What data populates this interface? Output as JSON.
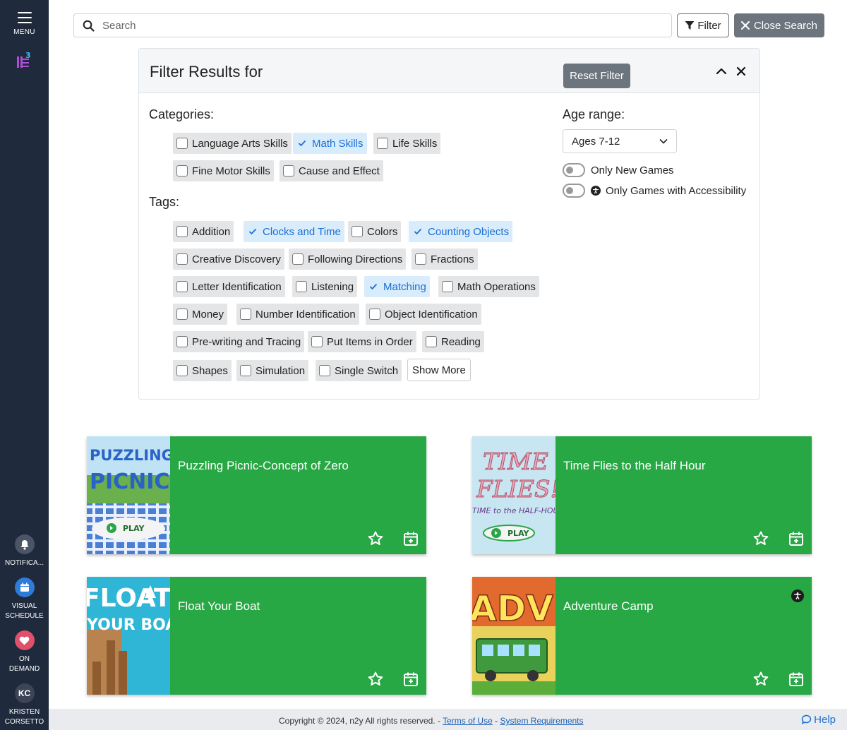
{
  "sidebar": {
    "menu_label": "MENU",
    "items": [
      {
        "label1": "NOTIFICA...",
        "label2": ""
      },
      {
        "label1": "VISUAL",
        "label2": "SCHEDULE"
      },
      {
        "label1": "ON",
        "label2": "DEMAND"
      },
      {
        "initials": "KC",
        "label1": "KRISTEN",
        "label2": "CORSETTO"
      }
    ]
  },
  "search": {
    "placeholder": "Search",
    "value": ""
  },
  "toolbar": {
    "filter_label": "Filter",
    "close_search_label": "Close Search"
  },
  "filter_panel": {
    "title": "Filter Results for",
    "reset_label": "Reset Filter",
    "categories_label": "Categories:",
    "categories": [
      {
        "label": "Language Arts Skills",
        "checked": false
      },
      {
        "label": "Math Skills",
        "checked": true
      },
      {
        "label": "Life Skills",
        "checked": false
      },
      {
        "label": "Fine Motor Skills",
        "checked": false
      },
      {
        "label": "Cause and Effect",
        "checked": false
      }
    ],
    "tags_label": "Tags:",
    "tags": [
      {
        "label": "Addition",
        "checked": false
      },
      {
        "label": "Clocks and Time",
        "checked": true
      },
      {
        "label": "Colors",
        "checked": false
      },
      {
        "label": "Counting Objects",
        "checked": true
      },
      {
        "label": "Creative Discovery",
        "checked": false
      },
      {
        "label": "Following Directions",
        "checked": false
      },
      {
        "label": "Fractions",
        "checked": false
      },
      {
        "label": "Letter Identification",
        "checked": false
      },
      {
        "label": "Listening",
        "checked": false
      },
      {
        "label": "Matching",
        "checked": true
      },
      {
        "label": "Math Operations",
        "checked": false
      },
      {
        "label": "Money",
        "checked": false
      },
      {
        "label": "Number Identification",
        "checked": false
      },
      {
        "label": "Object Identification",
        "checked": false
      },
      {
        "label": "Pre-writing and Tracing",
        "checked": false
      },
      {
        "label": "Put Items in Order",
        "checked": false
      },
      {
        "label": "Reading",
        "checked": false
      },
      {
        "label": "Shapes",
        "checked": false
      },
      {
        "label": "Simulation",
        "checked": false
      },
      {
        "label": "Single Switch",
        "checked": false
      }
    ],
    "show_more_label": "Show More",
    "age_range_label": "Age range:",
    "age_range_value": "Ages 7-12",
    "only_new_games_label": "Only New Games",
    "only_accessibility_label": "Only Games with Accessibility"
  },
  "games": [
    {
      "title": "Puzzling Picnic-Concept of Zero",
      "thumb_text1": "PUZZLING",
      "thumb_text2": "PICNIC",
      "play_label": "PLAY",
      "accessible": false
    },
    {
      "title": "Time Flies to the Half Hour",
      "thumb_text1": "TIME",
      "thumb_text2": "FLIES!",
      "thumb_text3": "TIME to the HALF-HOUR",
      "play_label": "PLAY",
      "accessible": false
    },
    {
      "title": "Float Your Boat",
      "thumb_text1": "FLOAT",
      "thumb_text2": "YOUR BOAT",
      "accessible": false
    },
    {
      "title": "Adventure Camp",
      "thumb_text1": "ADVE",
      "accessible": true
    }
  ],
  "footer": {
    "copyright": "Copyright © 2024, n2y All rights reserved. -",
    "terms_label": "Terms of Use",
    "separator": "-",
    "sysreq_label": "System Requirements",
    "help_label": "Help"
  },
  "colors": {
    "sidebar": "#1f2a3c",
    "card_green": "#27a844",
    "accent_blue": "#1a6fd4",
    "button_gray": "#6c757d"
  }
}
